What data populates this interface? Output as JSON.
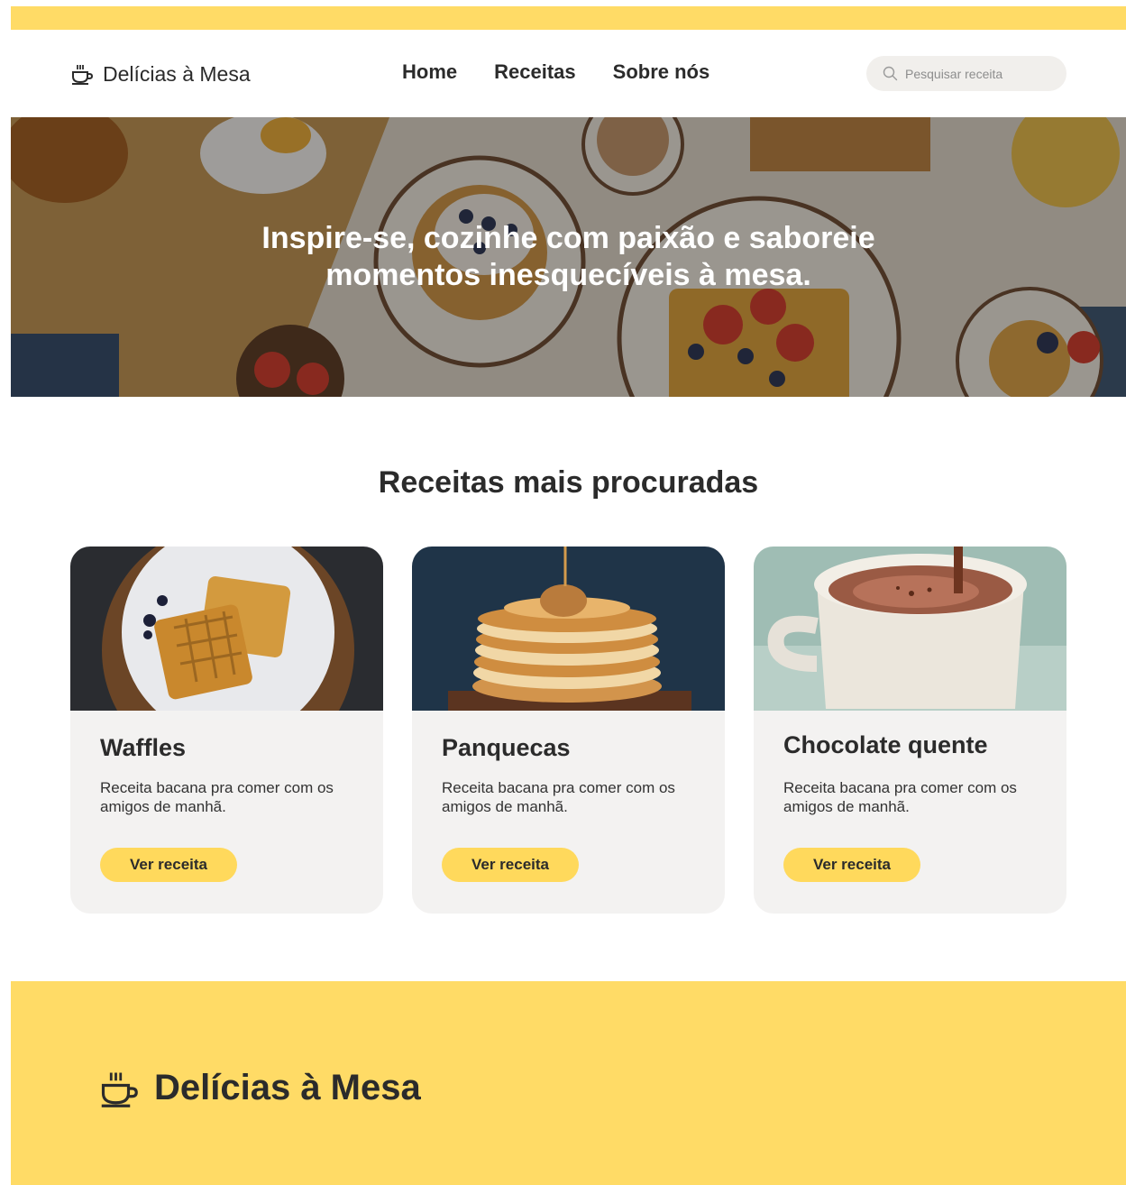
{
  "brand": {
    "name": "Delícias à Mesa",
    "icon": "coffee-cup-icon"
  },
  "nav": {
    "links": [
      "Home",
      "Receitas",
      "Sobre nós"
    ]
  },
  "search": {
    "placeholder": "Pesquisar receita",
    "icon": "search-icon"
  },
  "hero": {
    "title_line1": "Inspire-se, cozinhe com paixão e saboreie",
    "title_line2": "momentos inesquecíveis à mesa."
  },
  "section": {
    "title": "Receitas mais procuradas"
  },
  "cards": [
    {
      "title": "Waffles",
      "description": "Receita bacana pra comer com os amigos de manhã.",
      "button": "Ver receita"
    },
    {
      "title": "Panquecas",
      "description": "Receita bacana pra comer com os amigos de manhã.",
      "button": "Ver receita"
    },
    {
      "title": "Chocolate quente",
      "description": "Receita bacana pra comer com os amigos de manhã.",
      "button": "Ver receita"
    }
  ],
  "footer": {
    "brand": "Delícias à Mesa"
  },
  "colors": {
    "accent": "#ffdb66",
    "button": "#ffd95c",
    "card_bg": "#f3f2f1",
    "text": "#2b2b2b"
  }
}
